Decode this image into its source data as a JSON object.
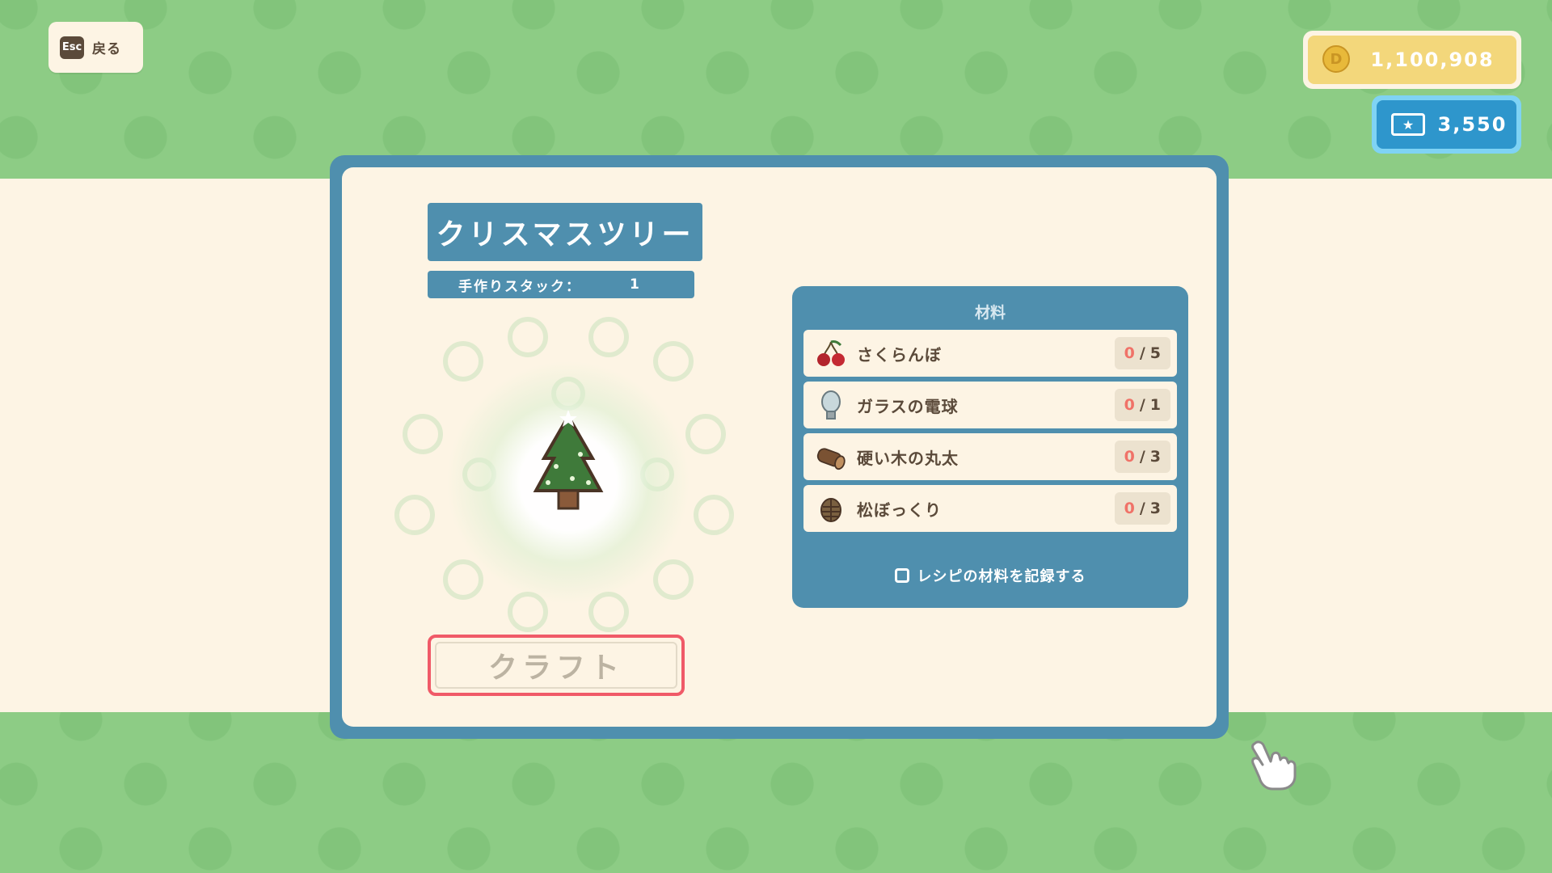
{
  "nav": {
    "esc_key": "Esc",
    "back_label": "戻る"
  },
  "currency": {
    "coins": "1,100,908",
    "tickets": "3,550"
  },
  "recipe": {
    "title": "クリスマスツリー",
    "stack_label": "手作りスタック：",
    "stack_value": "1"
  },
  "materials": {
    "header": "材料",
    "items": [
      {
        "name": "さくらんぼ",
        "have": "0",
        "need": "5",
        "icon": "cherry-icon"
      },
      {
        "name": "ガラスの電球",
        "have": "0",
        "need": "1",
        "icon": "glass-bulb-icon"
      },
      {
        "name": "硬い木の丸太",
        "have": "0",
        "need": "3",
        "icon": "log-icon"
      },
      {
        "name": "松ぼっくり",
        "have": "0",
        "need": "3",
        "icon": "pinecone-icon"
      }
    ],
    "record_label": "レシピの材料を記録する",
    "separator": "/"
  },
  "actions": {
    "craft_label": "クラフト"
  },
  "colors": {
    "background_green": "#8dcc85",
    "cream": "#fdf4e4",
    "panel_blue": "#4f8fae",
    "craft_border": "#f05a68",
    "count_red": "#f07268",
    "coin_gold": "#f3d77b",
    "ticket_blue": "#2e96cc"
  }
}
